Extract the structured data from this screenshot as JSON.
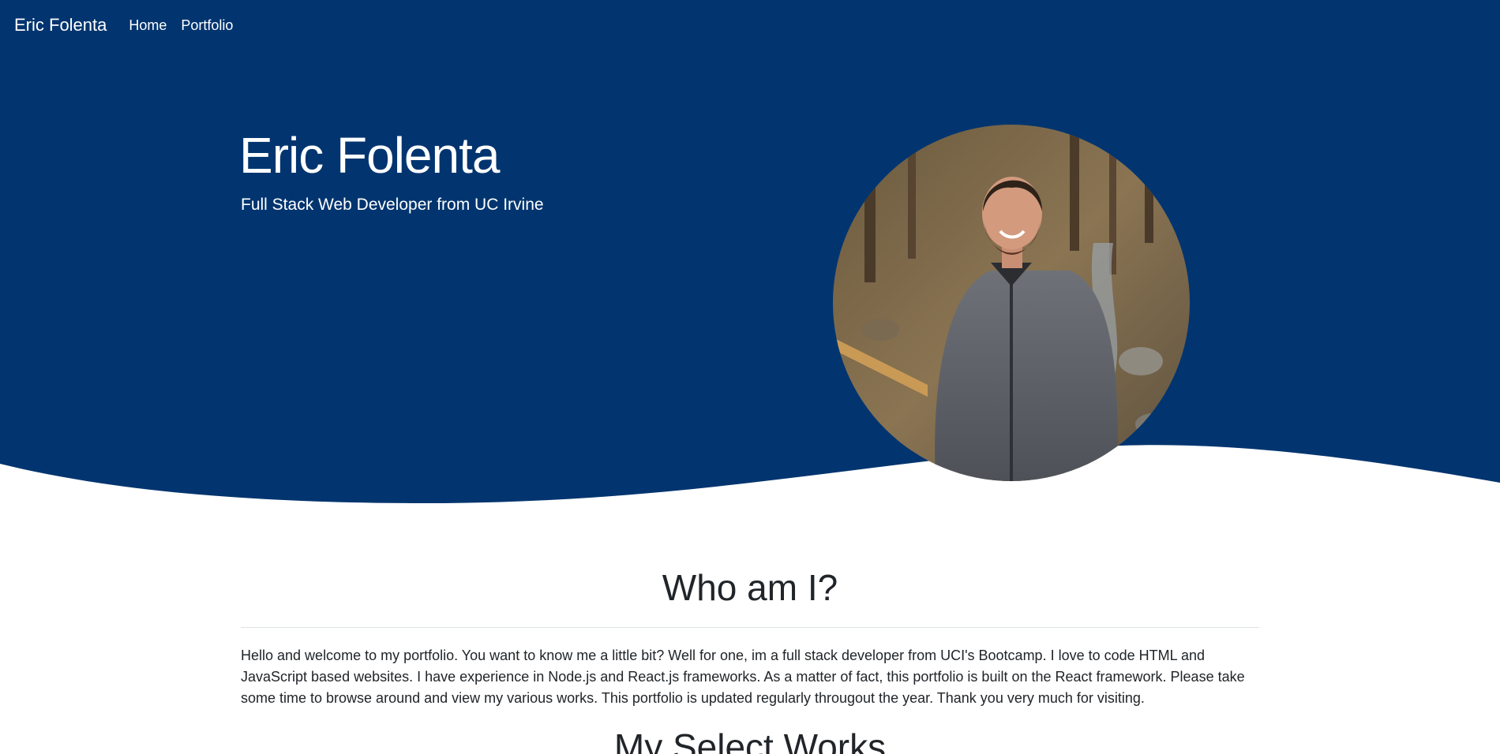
{
  "colors": {
    "hero_background": "#02356f",
    "text_primary": "#212529",
    "text_on_hero": "#ffffff"
  },
  "navbar": {
    "brand": "Eric Folenta",
    "links": [
      {
        "label": "Home"
      },
      {
        "label": "Portfolio"
      }
    ]
  },
  "hero": {
    "title": "Eric Folenta",
    "subtitle": "Full Stack Web Developer from UC Irvine",
    "photo_alt": "Eric Folenta portrait"
  },
  "about": {
    "title": "Who am I?",
    "body": "Hello and welcome to my portfolio. You want to know me a little bit? Well for one, im a full stack developer from UCI's Bootcamp. I love to code HTML and JavaScript based websites. I have experience in Node.js and React.js frameworks. As a matter of fact, this portfolio is built on the React framework. Please take some time to browse around and view my various works. This portfolio is updated regularly througout the year. Thank you very much for visiting."
  },
  "works": {
    "title": "My Select Works"
  }
}
